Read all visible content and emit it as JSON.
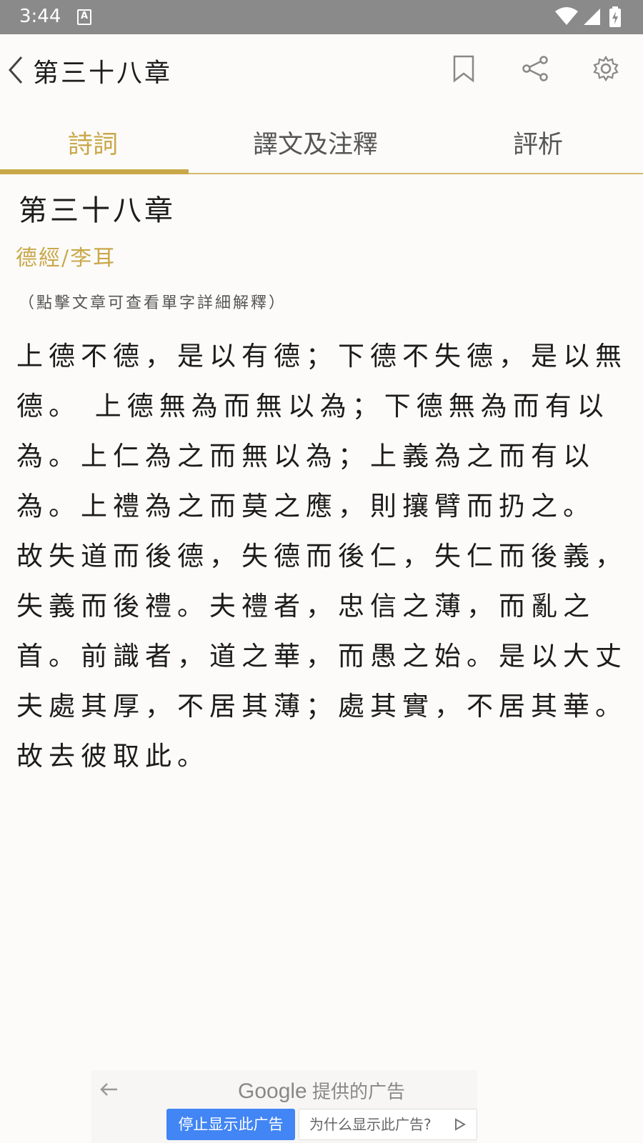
{
  "status_bar": {
    "time": "3:44",
    "notification_icon_letter": "A"
  },
  "app_bar": {
    "title": "第三十八章",
    "icons": [
      "back-icon",
      "bookmark-icon",
      "share-icon",
      "settings-icon"
    ]
  },
  "tabs": [
    {
      "label": "詩詞",
      "active": true
    },
    {
      "label": "譯文及注釋",
      "active": false
    },
    {
      "label": "評析",
      "active": false
    }
  ],
  "poem": {
    "title": "第三十八章",
    "author_line": "德經/李耳",
    "hint": "（點擊文章可查看單字詳細解釋）",
    "text": "上德不德，是以有德；下德不失德，是以無德。 上德無為而無以為；下德無為而有以為。上仁為之而無以為；上義為之而有以為。上禮為之而莫之應，則攘臂而扔之。 故失道而後德，失德而後仁，失仁而後義，失義而後禮。夫禮者，忠信之薄，而亂之首。前識者，道之華，而愚之始。是以大丈夫處其厚，不居其薄；處其實，不居其華。故去彼取此。"
  },
  "ad": {
    "brand": "Google",
    "provided_text": "提供的广告",
    "stop_label": "停止显示此广告",
    "why_label": "为什么显示此广告?"
  },
  "colors": {
    "accent": "#c9a84a",
    "status_bar": "#8a8a8a",
    "background": "#fcfbfa",
    "ad_button": "#4285f4"
  }
}
